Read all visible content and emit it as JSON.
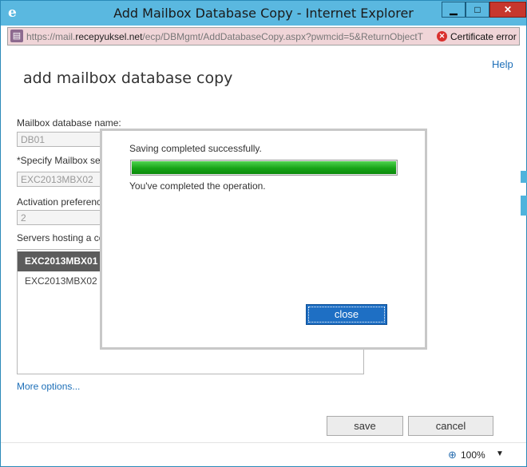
{
  "window": {
    "title": "Add Mailbox Database Copy - Internet Explorer",
    "min_glyph": "▁",
    "max_glyph": "□",
    "close_glyph": "✕"
  },
  "addressbar": {
    "url_prefix": "https://mail.",
    "url_domain": "recepyuksel.net",
    "url_path": "/ecp/DBMgmt/AddDatabaseCopy.aspx?pwmcid=5&ReturnObjectT",
    "cert_text": "Certificate error",
    "cert_glyph": "✕"
  },
  "page": {
    "help": "Help",
    "title": "add mailbox database copy",
    "mailbox_db_label": "Mailbox database name:",
    "mailbox_db_value": "DB01",
    "server_label": "*Specify Mailbox se",
    "server_value": "EXC2013MBX02",
    "activation_label": "Activation preferenc",
    "activation_value": "2",
    "servers_label": "Servers hosting a co",
    "servers": [
      "EXC2013MBX01",
      "EXC2013MBX02"
    ],
    "more_options": "More options...",
    "save": "save",
    "cancel": "cancel"
  },
  "modal": {
    "message": "Saving completed successfully.",
    "progress": 1.0,
    "sub_message": "You've completed the operation.",
    "close": "close"
  },
  "statusbar": {
    "zoom": "100%",
    "zoom_icon": "zoom-icon",
    "arrow": "▼"
  },
  "colors": {
    "titlebar": "#5ab8e0",
    "progress": "#16a316",
    "primary_button": "#1e6fc4",
    "link": "#1d6fb8"
  }
}
